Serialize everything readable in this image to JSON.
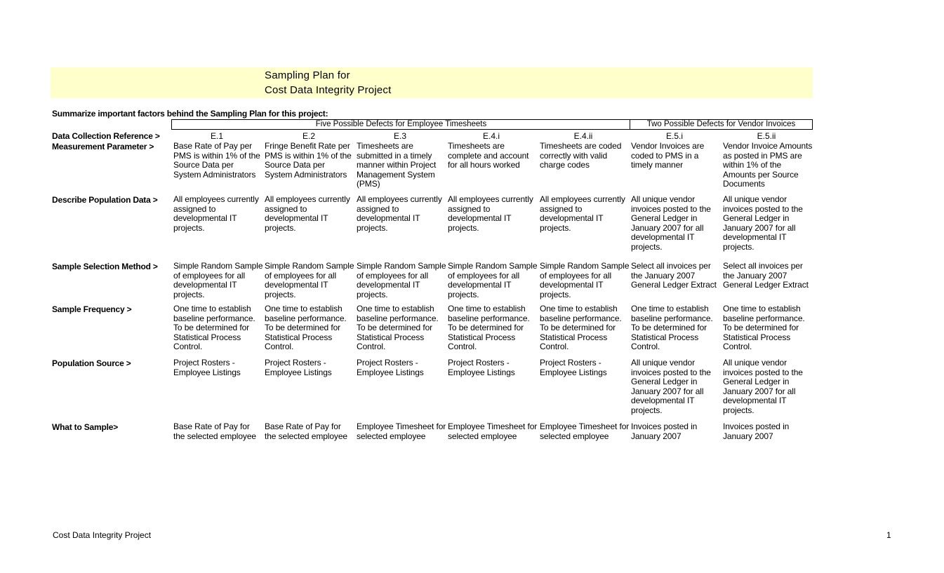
{
  "header": {
    "title_line1": "Sampling Plan for",
    "title_line2": "Cost Data Integrity Project",
    "band_color": "#ffffcc"
  },
  "summary_prompt": "Summarize important factors behind the Sampling Plan for this project:",
  "column_groups": [
    {
      "label": "Five Possible Defects for Employee Timesheets",
      "columns": [
        "E.1",
        "E.2",
        "E.3",
        "E.4.i",
        "E.4.ii"
      ]
    },
    {
      "label": "Two Possible Defects for Vendor Invoices",
      "columns": [
        "E.5.i",
        "E.5.ii"
      ]
    }
  ],
  "rows": {
    "reference": {
      "label": "Data Collection Reference >",
      "values": [
        "E.1",
        "E.2",
        "E.3",
        "E.4.i",
        "E.4.ii",
        "E.5.i",
        "E.5.ii"
      ]
    },
    "measurement": {
      "label": "Measurement Parameter >",
      "values": [
        "Base Rate of Pay per\nPMS is within 1% of the\nSource Data per\nSystem Administrators",
        "Fringe Benefit Rate per\nPMS is within 1% of the\nSource Data per\nSystem Administrators",
        "Timesheets are\nsubmitted in a timely\nmanner within Project\nManagement System\n(PMS)",
        "Timesheets are\ncomplete and account\nfor all hours worked",
        "Timesheets are coded\ncorrectly with valid\ncharge codes",
        "Vendor Invoices are\ncoded to PMS in a\ntimely manner",
        "Vendor Invoice Amounts\nas posted in PMS are\nwithin 1% of the\nAmounts per Source\nDocuments"
      ]
    },
    "population": {
      "label": "Describe Population Data >",
      "values": [
        "All employees currently\nassigned to\ndevelopmental IT\nprojects.",
        "All employees currently\nassigned to\ndevelopmental IT\nprojects.",
        "All employees currently\nassigned to\ndevelopmental IT\nprojects.",
        "All employees currently\nassigned to\ndevelopmental IT\nprojects.",
        "All employees currently\nassigned to\ndevelopmental IT\nprojects.",
        "All unique vendor\ninvoices posted to the\nGeneral Ledger in\nJanuary 2007 for all\ndevelopmental IT\nprojects.",
        "All unique vendor\ninvoices posted to the\nGeneral Ledger in\nJanuary 2007 for all\ndevelopmental IT\nprojects."
      ]
    },
    "selection": {
      "label": "Sample Selection Method >",
      "values": [
        "Simple Random Sample\nof employees for all\ndevelopmental IT\nprojects.",
        "Simple Random Sample\nof employees for all\ndevelopmental IT\nprojects.",
        "Simple Random Sample\nof employees for all\ndevelopmental IT\nprojects.",
        "Simple Random Sample\nof employees for all\ndevelopmental IT\nprojects.",
        "Simple Random Sample\nof employees for all\ndevelopmental IT\nprojects.",
        "Select all invoices per\nthe January 2007\nGeneral Ledger Extract",
        "Select all invoices per\nthe January 2007\nGeneral Ledger Extract"
      ]
    },
    "frequency": {
      "label": "Sample Frequency >",
      "values": [
        "One time to establish\nbaseline performance.\nTo be determined for\nStatistical Process\nControl.",
        "One time to establish\nbaseline performance.\nTo be determined for\nStatistical Process\nControl.",
        "One time to establish\nbaseline performance.\nTo be determined for\nStatistical Process\nControl.",
        "One time to establish\nbaseline performance.\nTo be determined for\nStatistical Process\nControl.",
        "One time to establish\nbaseline performance.\nTo be determined for\nStatistical Process\nControl.",
        "One time to establish\nbaseline performance.\nTo be determined for\nStatistical Process\nControl.",
        "One time to establish\nbaseline performance.\nTo be determined for\nStatistical Process\nControl."
      ]
    },
    "source": {
      "label": "Population Source >",
      "values": [
        "Project Rosters -\nEmployee Listings",
        "Project Rosters -\nEmployee Listings",
        "Project Rosters -\nEmployee Listings",
        "Project Rosters -\nEmployee Listings",
        "Project Rosters -\nEmployee Listings",
        "All unique vendor\ninvoices posted to the\nGeneral Ledger in\nJanuary 2007 for all\ndevelopmental IT\nprojects.",
        "All unique vendor\ninvoices posted to the\nGeneral Ledger in\nJanuary 2007 for all\ndevelopmental IT\nprojects."
      ]
    },
    "what": {
      "label": "What to Sample>",
      "values": [
        "Base Rate of Pay for\nthe selected employee",
        "Base Rate of Pay for\nthe selected employee",
        "Employee Timesheet for\nselected employee",
        "Employee Timesheet for\nselected employee",
        "Employee Timesheet for\nselected employee",
        "Invoices posted in\nJanuary 2007",
        "Invoices posted in\nJanuary 2007"
      ]
    }
  },
  "footer": {
    "left": "Cost Data Integrity Project",
    "page_number": "1"
  }
}
